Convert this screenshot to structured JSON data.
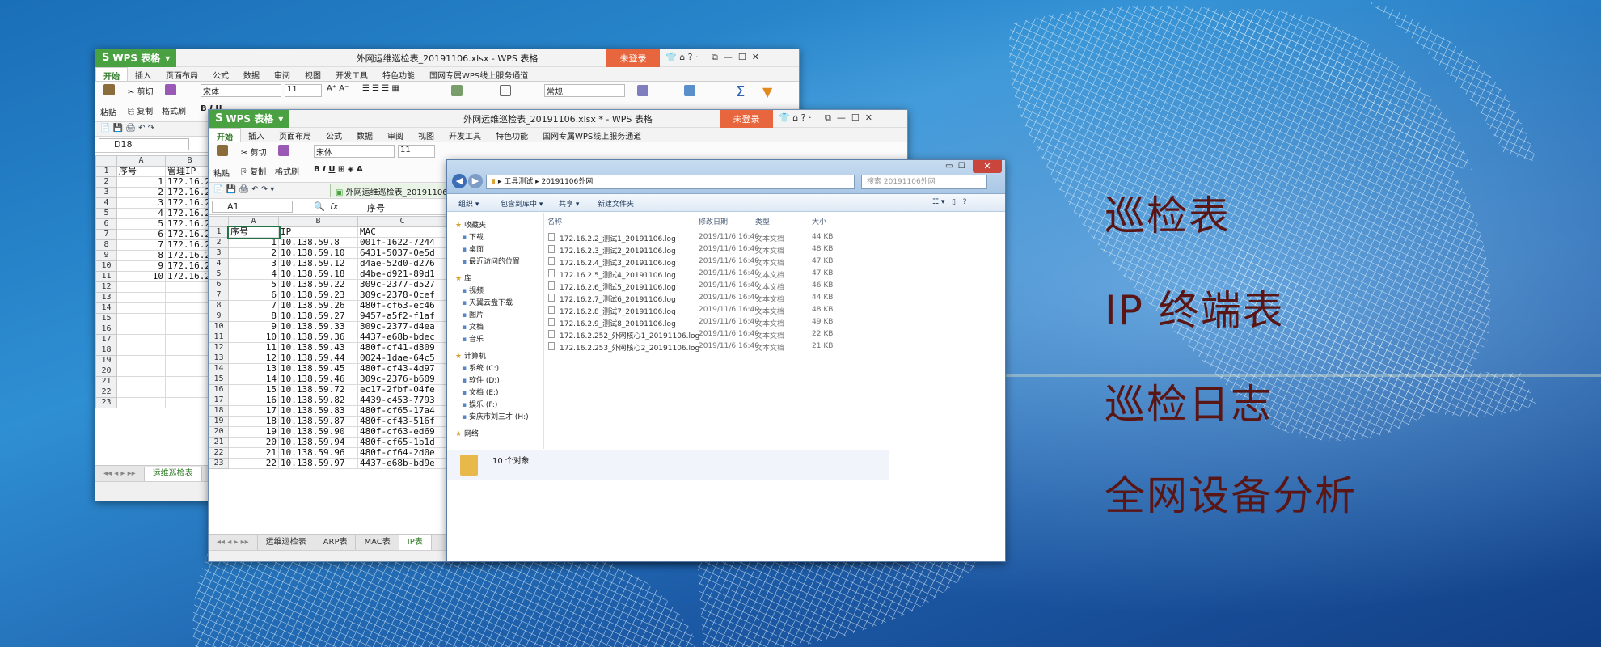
{
  "headlines": [
    "巡检表",
    "IP 终端表",
    "巡检日志",
    "全网设备分析"
  ],
  "win_back": {
    "logo": "WPS 表格",
    "title": "外网运维巡检表_20191106.xlsx - WPS 表格",
    "login": "未登录",
    "controls": "?·",
    "tabs": [
      "开始",
      "插入",
      "页面布局",
      "公式",
      "数据",
      "审阅",
      "视图",
      "开发工具",
      "特色功能",
      "国网专属WPS线上服务通道"
    ],
    "paste": "粘贴",
    "cut": "剪切",
    "copy": "复制",
    "format_painter": "格式刷",
    "font": "宋体",
    "font_size": "11",
    "number_format": "常规",
    "namebox": "D18",
    "col_headers": [
      "",
      "A",
      "B"
    ],
    "header_row": [
      "序号",
      "管理IP"
    ],
    "rows": [
      [
        "1",
        "172.16.2"
      ],
      [
        "2",
        "172.16.2"
      ],
      [
        "3",
        "172.16.2"
      ],
      [
        "4",
        "172.16.2"
      ],
      [
        "5",
        "172.16.2"
      ],
      [
        "6",
        "172.16.2"
      ],
      [
        "7",
        "172.16.2"
      ],
      [
        "8",
        "172.16.2"
      ],
      [
        "9",
        "172.16.2"
      ],
      [
        "10",
        "172.16.2"
      ]
    ],
    "row_count": 23,
    "sheet_tab": "运维巡检表"
  },
  "win_front": {
    "logo": "WPS 表格",
    "title": "外网运维巡检表_20191106.xlsx * - WPS 表格",
    "login": "未登录",
    "controls": "?·",
    "tabs": [
      "开始",
      "插入",
      "页面布局",
      "公式",
      "数据",
      "审阅",
      "视图",
      "开发工具",
      "特色功能",
      "国网专属WPS线上服务通道"
    ],
    "paste": "粘贴",
    "cut": "剪切",
    "copy": "复制",
    "format_painter": "格式刷",
    "font": "宋体",
    "font_size": "11",
    "doc_tab": "外网运维巡检表_20191106",
    "namebox": "A1",
    "fx": "fx",
    "formula": "序号",
    "col_headers": [
      "",
      "A",
      "B",
      "C"
    ],
    "header_row": [
      "序号",
      "IP",
      "MAC"
    ],
    "rows": [
      [
        "1",
        "10.138.59.8",
        "001f-1622-7244"
      ],
      [
        "2",
        "10.138.59.10",
        "6431-5037-0e5d"
      ],
      [
        "3",
        "10.138.59.12",
        "d4ae-52d0-d276"
      ],
      [
        "4",
        "10.138.59.18",
        "d4be-d921-89d1"
      ],
      [
        "5",
        "10.138.59.22",
        "309c-2377-d527"
      ],
      [
        "6",
        "10.138.59.23",
        "309c-2378-0cef"
      ],
      [
        "7",
        "10.138.59.26",
        "480f-cf63-ec46"
      ],
      [
        "8",
        "10.138.59.27",
        "9457-a5f2-f1af"
      ],
      [
        "9",
        "10.138.59.33",
        "309c-2377-d4ea"
      ],
      [
        "10",
        "10.138.59.36",
        "4437-e68b-bdec"
      ],
      [
        "11",
        "10.138.59.43",
        "480f-cf41-d809"
      ],
      [
        "12",
        "10.138.59.44",
        "0024-1dae-64c5"
      ],
      [
        "13",
        "10.138.59.45",
        "480f-cf43-4d97"
      ],
      [
        "14",
        "10.138.59.46",
        "309c-2376-b609"
      ],
      [
        "15",
        "10.138.59.72",
        "ec17-2fbf-04fe"
      ],
      [
        "16",
        "10.138.59.82",
        "4439-c453-7793"
      ],
      [
        "17",
        "10.138.59.83",
        "480f-cf65-17a4"
      ],
      [
        "18",
        "10.138.59.87",
        "480f-cf43-516f"
      ],
      [
        "19",
        "10.138.59.90",
        "480f-cf63-ed69"
      ],
      [
        "20",
        "10.138.59.94",
        "480f-cf65-1b1d"
      ],
      [
        "21",
        "10.138.59.96",
        "480f-cf64-2d0e"
      ],
      [
        "22",
        "10.138.59.97",
        "4437-e68b-bd9e"
      ]
    ],
    "sheet_tabs": [
      "运维巡检表",
      "ARP表",
      "MAC表",
      "IP表"
    ]
  },
  "explorer": {
    "breadcrumb": "▸  工具测试  ▸  20191106外网",
    "search_placeholder": "搜索 20191106外网",
    "toolbar": [
      "组织 ▾",
      "包含到库中 ▾",
      "共享 ▾",
      "新建文件夹"
    ],
    "nav": [
      {
        "label": "收藏夹",
        "group": true
      },
      {
        "label": "下载"
      },
      {
        "label": "桌面"
      },
      {
        "label": "最近访问的位置"
      },
      {
        "label": "库",
        "group": true
      },
      {
        "label": "视频"
      },
      {
        "label": "天翼云盘下载"
      },
      {
        "label": "图片"
      },
      {
        "label": "文档"
      },
      {
        "label": "音乐"
      },
      {
        "label": "计算机",
        "group": true
      },
      {
        "label": "系统 (C:)"
      },
      {
        "label": "软件 (D:)"
      },
      {
        "label": "文档 (E:)"
      },
      {
        "label": "娱乐 (F:)"
      },
      {
        "label": "安庆市刘三才 (H:)"
      },
      {
        "label": "网络",
        "group": true
      }
    ],
    "columns": [
      "名称",
      "修改日期",
      "类型",
      "大小"
    ],
    "files": [
      {
        "name": "172.16.2.2_测试1_20191106.log",
        "date": "2019/11/6 16:40",
        "type": "文本文档",
        "size": "44 KB"
      },
      {
        "name": "172.16.2.3_测试2_20191106.log",
        "date": "2019/11/6 16:40",
        "type": "文本文档",
        "size": "48 KB"
      },
      {
        "name": "172.16.2.4_测试3_20191106.log",
        "date": "2019/11/6 16:40",
        "type": "文本文档",
        "size": "47 KB"
      },
      {
        "name": "172.16.2.5_测试4_20191106.log",
        "date": "2019/11/6 16:40",
        "type": "文本文档",
        "size": "47 KB"
      },
      {
        "name": "172.16.2.6_测试5_20191106.log",
        "date": "2019/11/6 16:40",
        "type": "文本文档",
        "size": "46 KB"
      },
      {
        "name": "172.16.2.7_测试6_20191106.log",
        "date": "2019/11/6 16:40",
        "type": "文本文档",
        "size": "44 KB"
      },
      {
        "name": "172.16.2.8_测试7_20191106.log",
        "date": "2019/11/6 16:40",
        "type": "文本文档",
        "size": "48 KB"
      },
      {
        "name": "172.16.2.9_测试8_20191106.log",
        "date": "2019/11/6 16:40",
        "type": "文本文档",
        "size": "49 KB"
      },
      {
        "name": "172.16.2.252_外网核心1_20191106.log",
        "date": "2019/11/6 16:40",
        "type": "文本文档",
        "size": "22 KB"
      },
      {
        "name": "172.16.2.253_外网核心2_20191106.log",
        "date": "2019/11/6 16:40",
        "type": "文本文档",
        "size": "21 KB"
      }
    ],
    "status": "10 个对象"
  }
}
